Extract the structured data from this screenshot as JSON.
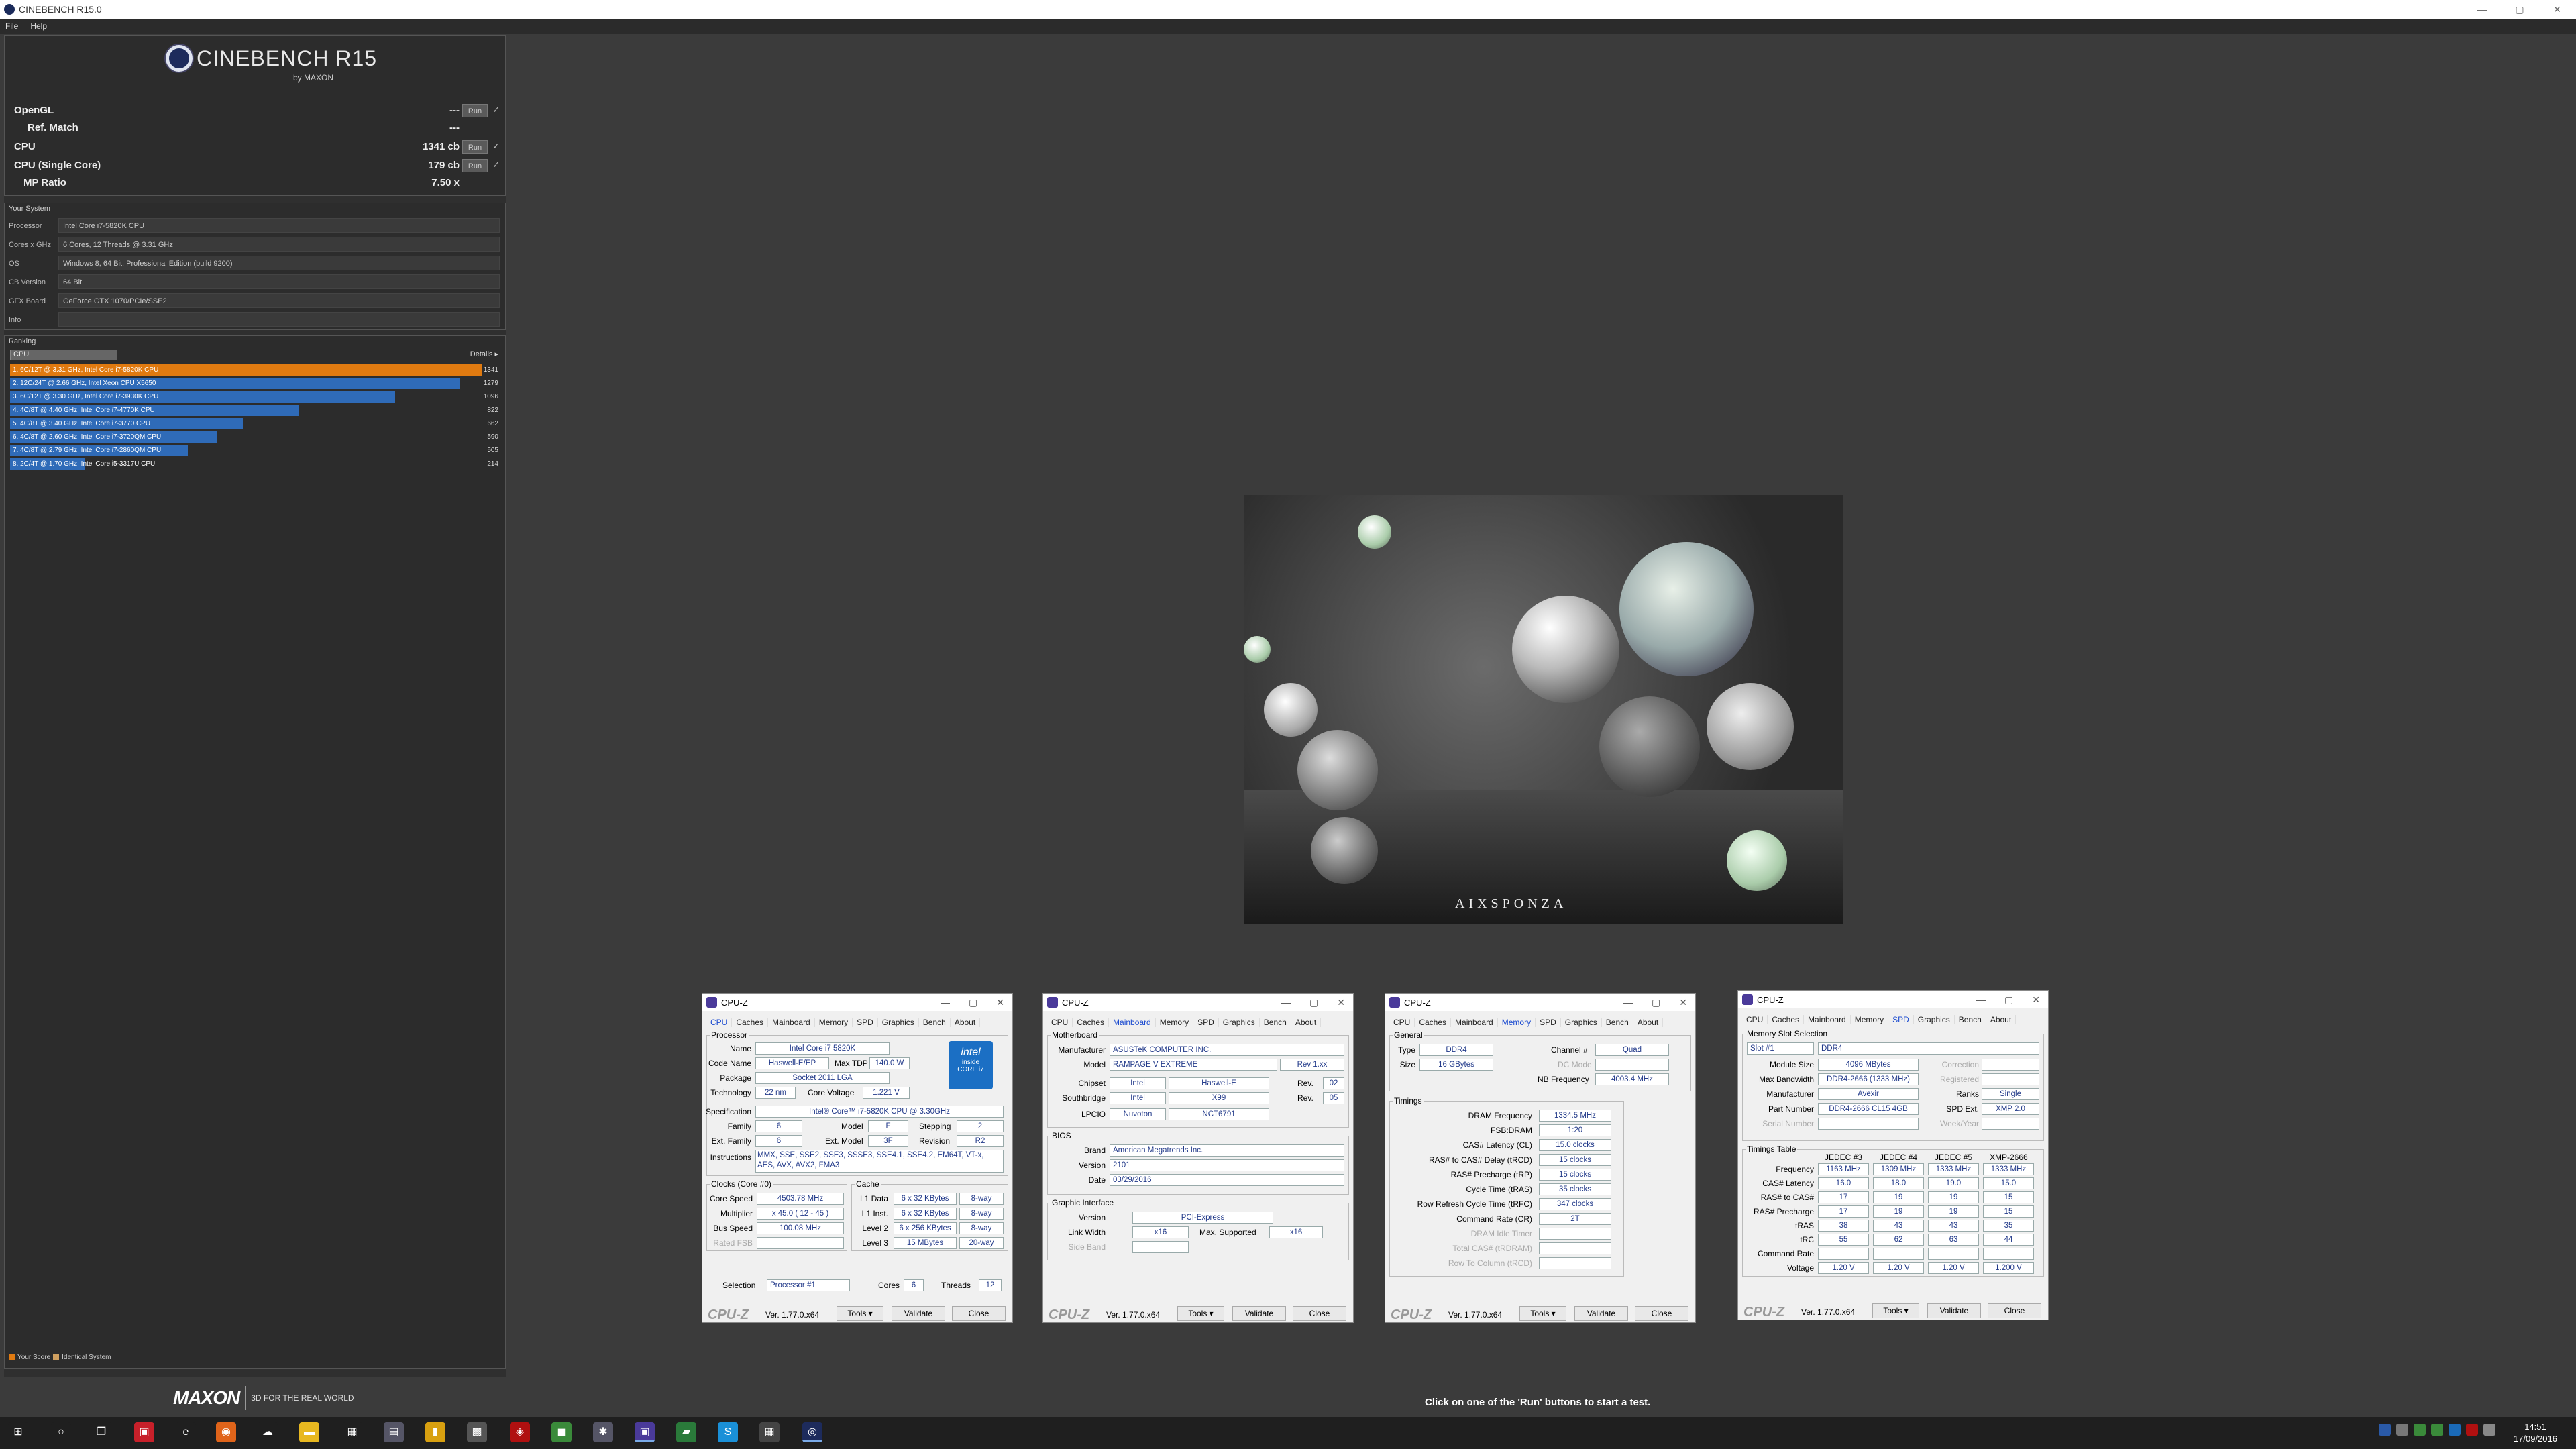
{
  "window": {
    "title": "CINEBENCH R15.0",
    "controls": [
      "—",
      "▢",
      "✕"
    ]
  },
  "menu": [
    "File",
    "Help"
  ],
  "logo": {
    "name": "CINEBENCH R15",
    "sub": "by MAXON"
  },
  "scores": [
    {
      "label": "OpenGL",
      "value": "---",
      "run": "Run",
      "check": "✓"
    },
    {
      "label": "Ref. Match",
      "value": "---"
    },
    {
      "label": "CPU",
      "value": "1341 cb",
      "run": "Run",
      "check": "✓"
    },
    {
      "label": "CPU (Single Core)",
      "value": "179 cb",
      "run": "Run",
      "check": "✓"
    },
    {
      "label": "MP Ratio",
      "value": "7.50 x"
    }
  ],
  "system": {
    "title": "Your System",
    "rows": [
      {
        "k": "Processor",
        "v": "Intel Core i7-5820K CPU"
      },
      {
        "k": "Cores x GHz",
        "v": "6 Cores, 12 Threads @ 3.31 GHz"
      },
      {
        "k": "OS",
        "v": "Windows 8, 64 Bit, Professional Edition (build 9200)"
      },
      {
        "k": "CB Version",
        "v": "64 Bit"
      },
      {
        "k": "GFX Board",
        "v": "GeForce GTX 1070/PCIe/SSE2"
      },
      {
        "k": "Info",
        "v": ""
      }
    ]
  },
  "ranking": {
    "title": "Ranking",
    "select": "CPU",
    "details": "Details",
    "max": 1341,
    "colors": {
      "own": "#e07a10",
      "other": "#2f6bb8"
    },
    "entries": [
      {
        "label": "1. 6C/12T @ 3.31 GHz, Intel Core i7-5820K CPU",
        "score": 1341,
        "own": true
      },
      {
        "label": "2. 12C/24T @ 2.66 GHz, Intel Xeon CPU X5650",
        "score": 1279
      },
      {
        "label": "3. 6C/12T @ 3.30 GHz, Intel Core i7-3930K CPU",
        "score": 1096
      },
      {
        "label": "4. 4C/8T @ 4.40 GHz, Intel Core i7-4770K CPU",
        "score": 822
      },
      {
        "label": "5. 4C/8T @ 3.40 GHz, Intel Core i7-3770 CPU",
        "score": 662
      },
      {
        "label": "6. 4C/8T @ 2.60 GHz, Intel Core i7-3720QM CPU",
        "score": 590
      },
      {
        "label": "7. 4C/8T @ 2.79 GHz, Intel Core i7-2860QM CPU",
        "score": 505
      },
      {
        "label": "8. 2C/4T @ 1.70 GHz, Intel Core i5-3317U CPU",
        "score": 214
      }
    ],
    "legend": [
      "Your Score",
      "Identical System"
    ]
  },
  "footer": {
    "maxon": "MAXON",
    "tagline": "3D FOR THE REAL WORLD",
    "status": "Click on one of the 'Run' buttons to start a test."
  },
  "render": {
    "brand": "AIXSPONZA"
  },
  "cpuz_common": {
    "title": "CPU-Z",
    "brand": "CPU-Z",
    "version": "Ver. 1.77.0.x64",
    "tools": "Tools",
    "validate": "Validate",
    "close": "Close",
    "tabs": [
      "CPU",
      "Caches",
      "Mainboard",
      "Memory",
      "SPD",
      "Graphics",
      "Bench",
      "About"
    ]
  },
  "cpuz_cpu": {
    "processor": "Processor",
    "name": "Intel Core i7 5820K",
    "codename": "Haswell-E/EP",
    "maxtdp": "140.0 W",
    "package": "Socket 2011 LGA",
    "technology": "22 nm",
    "voltage": "1.221 V",
    "spec": "Intel® Core™ i7-5820K CPU @ 3.30GHz",
    "family": "6",
    "model": "F",
    "stepping": "2",
    "extfamily": "6",
    "extmodel": "3F",
    "revision": "R2",
    "instructions": "MMX, SSE, SSE2, SSE3, SSSE3, SSE4.1, SSE4.2, EM64T, VT-x, AES, AVX, AVX2, FMA3",
    "clocks_title": "Clocks (Core #0)",
    "corespeed": "4503.78 MHz",
    "multiplier": "x 45.0 ( 12 - 45 )",
    "busspeed": "100.08 MHz",
    "ratedfsb": "",
    "cache_title": "Cache",
    "l1d": "6 x 32 KBytes",
    "l1d_w": "8-way",
    "l1i": "6 x 32 KBytes",
    "l1i_w": "8-way",
    "l2": "6 x 256 KBytes",
    "l2_w": "8-way",
    "l3": "15 MBytes",
    "l3_w": "20-way",
    "selection": "Processor #1",
    "cores": "6",
    "threads": "12",
    "labels": {
      "name": "Name",
      "codename": "Code Name",
      "maxtdp": "Max TDP",
      "package": "Package",
      "technology": "Technology",
      "voltage": "Core Voltage",
      "spec": "Specification",
      "family": "Family",
      "model": "Model",
      "stepping": "Stepping",
      "extfamily": "Ext. Family",
      "extmodel": "Ext. Model",
      "revision": "Revision",
      "instructions": "Instructions",
      "corespeed": "Core Speed",
      "multiplier": "Multiplier",
      "busspeed": "Bus Speed",
      "ratedfsb": "Rated FSB",
      "l1d": "L1 Data",
      "l1i": "L1 Inst.",
      "l2": "Level 2",
      "l3": "Level 3",
      "selection": "Selection",
      "cores": "Cores",
      "threads": "Threads"
    },
    "intel": {
      "top": "intel",
      "mid": "inside",
      "bot": "CORE i7"
    }
  },
  "cpuz_mb": {
    "mb_title": "Motherboard",
    "manufacturer": "ASUSTeK COMPUTER INC.",
    "model": "RAMPAGE V EXTREME",
    "model_rev": "Rev 1.xx",
    "chipset": "Intel",
    "chipset2": "Haswell-E",
    "chipset_rev": "02",
    "south": "Intel",
    "south2": "X99",
    "south_rev": "05",
    "lpcio": "Nuvoton",
    "lpcio2": "NCT6791",
    "bios_title": "BIOS",
    "brand": "American Megatrends Inc.",
    "version": "2101",
    "date": "03/29/2016",
    "gi_title": "Graphic Interface",
    "gi_version": "PCI-Express",
    "linkwidth": "x16",
    "maxsupported": "x16",
    "sideband": "",
    "labels": {
      "manufacturer": "Manufacturer",
      "model": "Model",
      "chipset": "Chipset",
      "south": "Southbridge",
      "lpcio": "LPCIO",
      "rev": "Rev.",
      "brand": "Brand",
      "version": "Version",
      "date": "Date",
      "gi_version": "Version",
      "linkwidth": "Link Width",
      "maxsupported": "Max. Supported",
      "sideband": "Side Band"
    }
  },
  "cpuz_mem": {
    "general_title": "General",
    "type": "DDR4",
    "channel": "Quad",
    "size": "16 GBytes",
    "dcmode": "",
    "nbfreq": "4003.4 MHz",
    "timings_title": "Timings",
    "timings": [
      {
        "k": "DRAM Frequency",
        "v": "1334.5 MHz"
      },
      {
        "k": "FSB:DRAM",
        "v": "1:20"
      },
      {
        "k": "CAS# Latency (CL)",
        "v": "15.0 clocks"
      },
      {
        "k": "RAS# to CAS# Delay (tRCD)",
        "v": "15 clocks"
      },
      {
        "k": "RAS# Precharge (tRP)",
        "v": "15 clocks"
      },
      {
        "k": "Cycle Time (tRAS)",
        "v": "35 clocks"
      },
      {
        "k": "Row Refresh Cycle Time (tRFC)",
        "v": "347 clocks"
      },
      {
        "k": "Command Rate (CR)",
        "v": "2T"
      },
      {
        "k": "DRAM Idle Timer",
        "v": "",
        "dim": true
      },
      {
        "k": "Total CAS# (tRDRAM)",
        "v": "",
        "dim": true
      },
      {
        "k": "Row To Column (tRCD)",
        "v": "",
        "dim": true
      }
    ],
    "labels": {
      "type": "Type",
      "channel": "Channel #",
      "size": "Size",
      "dcmode": "DC Mode",
      "nbfreq": "NB Frequency"
    }
  },
  "cpuz_spd": {
    "slot_title": "Memory Slot Selection",
    "slot": "Slot #1",
    "slottype": "DDR4",
    "modulesize": "4096 MBytes",
    "maxbw": "DDR4-2666 (1333 MHz)",
    "manufacturer": "Avexir",
    "ranks": "Single",
    "partnumber": "DDR4-2666 CL15 4GB",
    "spdext": "XMP 2.0",
    "serial": "",
    "weekyear": "",
    "correction": "",
    "registered": "",
    "labels": {
      "modulesize": "Module Size",
      "maxbw": "Max Bandwidth",
      "manufacturer": "Manufacturer",
      "ranks": "Ranks",
      "partnumber": "Part Number",
      "spdext": "SPD Ext.",
      "serial": "Serial Number",
      "weekyear": "Week/Year",
      "correction": "Correction",
      "registered": "Registered"
    },
    "tt_title": "Timings Table",
    "tt_headers": [
      "JEDEC #3",
      "JEDEC #4",
      "JEDEC #5",
      "XMP-2666"
    ],
    "tt_rows": [
      {
        "k": "Frequency",
        "v": [
          "1163 MHz",
          "1309 MHz",
          "1333 MHz",
          "1333 MHz"
        ]
      },
      {
        "k": "CAS# Latency",
        "v": [
          "16.0",
          "18.0",
          "19.0",
          "15.0"
        ]
      },
      {
        "k": "RAS# to CAS#",
        "v": [
          "17",
          "19",
          "19",
          "15"
        ]
      },
      {
        "k": "RAS# Precharge",
        "v": [
          "17",
          "19",
          "19",
          "15"
        ]
      },
      {
        "k": "tRAS",
        "v": [
          "38",
          "43",
          "43",
          "35"
        ]
      },
      {
        "k": "tRC",
        "v": [
          "55",
          "62",
          "63",
          "44"
        ]
      },
      {
        "k": "Command Rate",
        "v": [
          "",
          "",
          "",
          ""
        ]
      },
      {
        "k": "Voltage",
        "v": [
          "1.20 V",
          "1.20 V",
          "1.20 V",
          "1.200 V"
        ]
      }
    ]
  },
  "taskbar": {
    "items": [
      {
        "name": "start-icon",
        "glyph": "⊞",
        "color": "#1f1f1f"
      },
      {
        "name": "search-icon",
        "glyph": "○",
        "color": "#1f1f1f"
      },
      {
        "name": "task-view-icon",
        "glyph": "❐",
        "color": "#1f1f1f"
      },
      {
        "name": "app-red-icon",
        "glyph": "▣",
        "color": "#c8202a"
      },
      {
        "name": "edge-icon",
        "glyph": "e",
        "color": "#1f1f1f"
      },
      {
        "name": "firefox-icon",
        "glyph": "◉",
        "color": "#e0641a"
      },
      {
        "name": "app-cloud-icon",
        "glyph": "☁",
        "color": "#1f1f1f"
      },
      {
        "name": "explorer-icon",
        "glyph": "▬",
        "color": "#e8b820"
      },
      {
        "name": "app-grid-icon",
        "glyph": "▦",
        "color": "#1f1f1f"
      },
      {
        "name": "app-photo-icon",
        "glyph": "▤",
        "color": "#556"
      },
      {
        "name": "app-yellow-icon",
        "glyph": "▮",
        "color": "#d8a010"
      },
      {
        "name": "app-calc-icon",
        "glyph": "▩",
        "color": "#555"
      },
      {
        "name": "msi-icon",
        "glyph": "◈",
        "color": "#b01010"
      },
      {
        "name": "app-color-icon",
        "glyph": "◼",
        "color": "#3a8a3a"
      },
      {
        "name": "app-fan-icon",
        "glyph": "✱",
        "color": "#556"
      },
      {
        "name": "cpuz-icon",
        "glyph": "▣",
        "color": "#4a3a9a",
        "active": true
      },
      {
        "name": "app-green-icon",
        "glyph": "▰",
        "color": "#2a7a3a"
      },
      {
        "name": "skype-icon",
        "glyph": "S",
        "color": "#1a90d8"
      },
      {
        "name": "calculator-icon",
        "glyph": "▦",
        "color": "#444"
      },
      {
        "name": "cinebench-icon",
        "glyph": "◎",
        "color": "#1d2b5c",
        "active": true
      }
    ],
    "time": "14:51",
    "date": "17/09/2016"
  }
}
